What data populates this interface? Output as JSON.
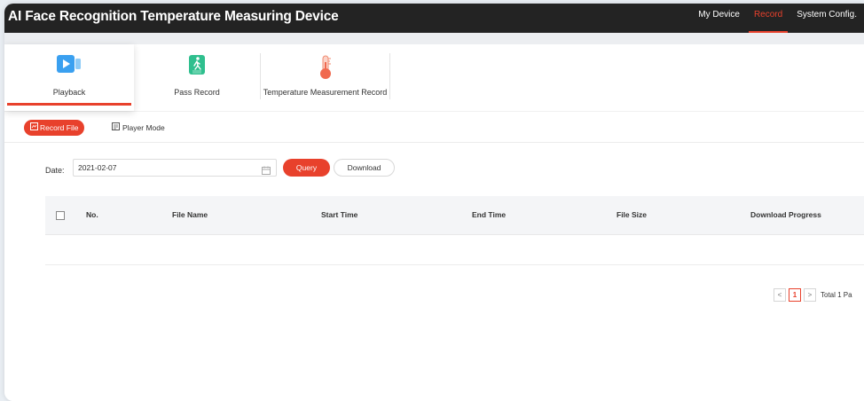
{
  "app": {
    "title": "AI Face Recognition Temperature Measuring Device"
  },
  "topnav": [
    {
      "label": "My Device",
      "active": false
    },
    {
      "label": "Record",
      "active": true
    },
    {
      "label": "System Config.",
      "active": false
    }
  ],
  "tabs": [
    {
      "label": "Playback",
      "icon": "video-icon",
      "active": true
    },
    {
      "label": "Pass Record",
      "icon": "walking-person-icon",
      "active": false
    },
    {
      "label": "Temperature Measurement Record",
      "icon": "thermometer-icon",
      "active": false
    }
  ],
  "subbar": {
    "record_file": "Record File",
    "player_mode": "Player Mode"
  },
  "filter": {
    "date_label": "Date:",
    "date_value": "2021-02-07",
    "query": "Query",
    "download": "Download"
  },
  "table": {
    "columns": [
      "No.",
      "File Name",
      "Start Time",
      "End Time",
      "File Size",
      "Download Progress"
    ],
    "rows": []
  },
  "pager": {
    "prev": "<",
    "current": "1",
    "next": ">",
    "total": "Total 1 Pa"
  },
  "colors": {
    "accent": "#e8412c",
    "topbar": "#232323"
  }
}
